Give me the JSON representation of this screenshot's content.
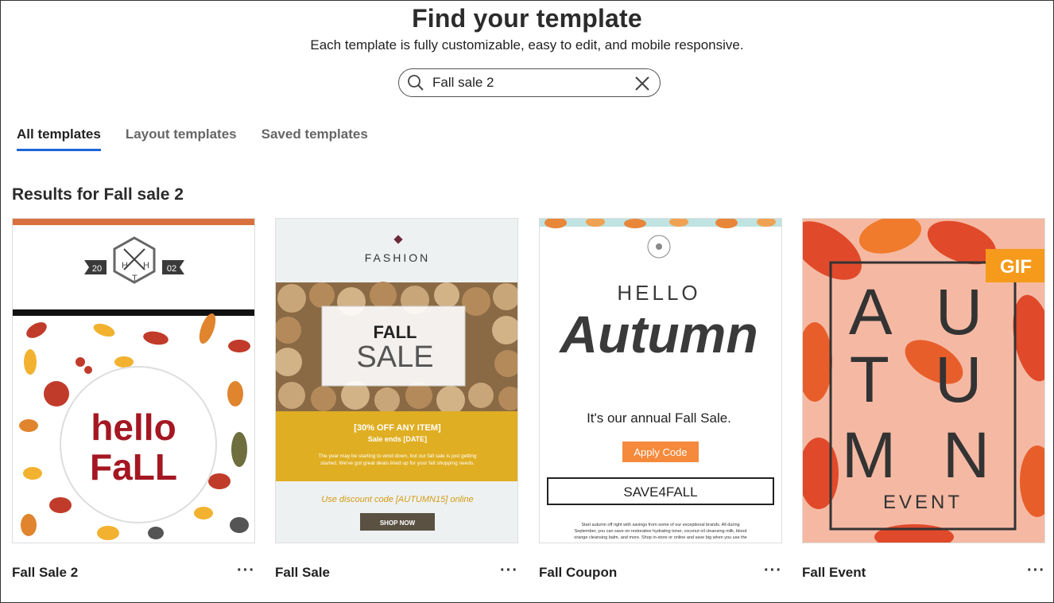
{
  "header": {
    "title": "Find your template",
    "subtitle": "Each template is fully customizable, easy to edit, and mobile responsive."
  },
  "search": {
    "value": "Fall sale 2",
    "placeholder": ""
  },
  "tabs": [
    {
      "label": "All templates",
      "active": true
    },
    {
      "label": "Layout templates",
      "active": false
    },
    {
      "label": "Saved templates",
      "active": false
    }
  ],
  "results": {
    "heading": "Results for Fall sale 2"
  },
  "cards": [
    {
      "name": "Fall Sale 2",
      "thumb": {
        "badge_left": "20",
        "badge_right": "02",
        "monogram": [
          "H",
          "H",
          "T"
        ],
        "line1": "hello",
        "line2": "FaLL"
      }
    },
    {
      "name": "Fall Sale",
      "thumb": {
        "brand": "FASHION",
        "headline1": "FALL",
        "headline2": "SALE",
        "offer": "[30% OFF ANY ITEM]",
        "sale_ends": "Sale ends [DATE]",
        "body1": "The year may be starting to wind down, but our fall sale is just getting",
        "body2": "started. We've got great deals lined up for your fall shopping needs.",
        "discount": "Use discount code [AUTUMN15] online",
        "cta": "SHOP NOW"
      }
    },
    {
      "name": "Fall Coupon",
      "thumb": {
        "hello": "HELLO",
        "script": "Autumn",
        "tagline": "It's our annual Fall Sale.",
        "cta": "Apply Code",
        "code": "SAVE4FALL",
        "fine1": "Start autumn off right with savings from some of our exceptional brands. All during",
        "fine2": "September, you can save on restorative hydrating toner, coconut oil cleansing milk, blood",
        "fine3": "orange cleansing balm, and more. Shop in-store or online and save big when you use the"
      }
    },
    {
      "name": "Fall Event",
      "thumb": {
        "badge": "GIF",
        "rows": [
          "A U",
          "T U",
          "M N"
        ],
        "event": "EVENT"
      }
    }
  ],
  "icons": {
    "search": "search-icon",
    "clear": "close-icon",
    "more": "more-horizontal-icon"
  },
  "colors": {
    "accent": "#1e66d8",
    "coupon_cta": "#f58a3c",
    "fall_sale_band": "#e0ae22",
    "event_badge": "#f59a1b"
  }
}
